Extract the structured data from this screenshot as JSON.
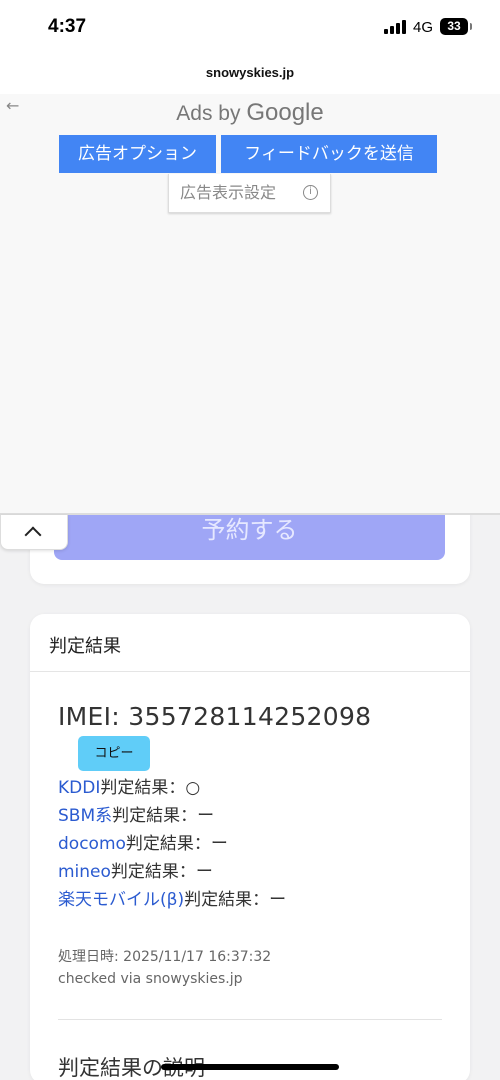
{
  "status": {
    "time": "4:37",
    "network": "4G",
    "battery": "33"
  },
  "browser": {
    "url": "snowyskies.jp"
  },
  "ad": {
    "back_icon": "arrow-left-icon",
    "ads_by_prefix": "Ads by",
    "ads_by_brand": "Google",
    "options_button": "広告オプション",
    "feedback_button": "フィードバックを送信",
    "settings_link": "広告表示設定",
    "settings_icon": "info-icon",
    "accent_color": "#4285f4"
  },
  "collapse": {
    "icon": "chevron-up-icon"
  },
  "reserve": {
    "label": "予約する",
    "color": "#9fa6f6"
  },
  "result_card": {
    "header": "判定結果",
    "imei_label": "IMEI:",
    "imei": "355728114252098",
    "copy_label": "コピー",
    "rows": [
      {
        "carrier": "KDDI",
        "suffix": "判定結果：",
        "value": "○"
      },
      {
        "carrier": "SBM系",
        "suffix": "判定結果：",
        "value": "ー"
      },
      {
        "carrier": "docomo",
        "suffix": "判定結果：",
        "value": "ー"
      },
      {
        "carrier": "mineo",
        "suffix": "判定結果：",
        "value": "ー"
      },
      {
        "carrier": "楽天モバイル(β)",
        "suffix": "判定結果：",
        "value": "ー"
      }
    ],
    "processed_label": "処理日時:",
    "processed_at": "2025/11/17 16:37:32",
    "checked_via": "checked via snowyskies.jp",
    "explanation_title": "判定結果の説明"
  }
}
